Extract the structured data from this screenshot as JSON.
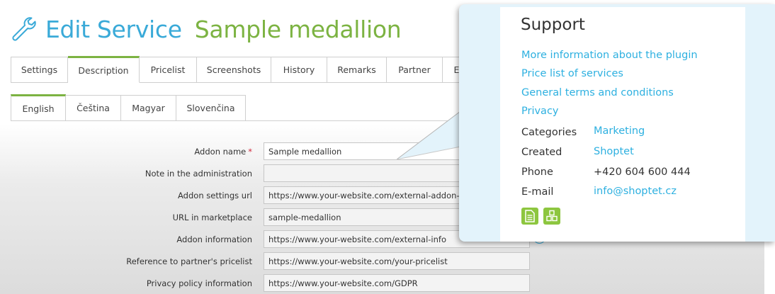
{
  "header": {
    "title": "Edit Service",
    "subtitle": "Sample medallion",
    "icon": "wrench-icon"
  },
  "tabs": [
    {
      "label": "Settings",
      "active": false
    },
    {
      "label": "Description",
      "active": true
    },
    {
      "label": "Pricelist",
      "active": false
    },
    {
      "label": "Screenshots",
      "active": false
    },
    {
      "label": "History",
      "active": false
    },
    {
      "label": "Remarks",
      "active": false
    },
    {
      "label": "Partner",
      "active": false
    },
    {
      "label": "E",
      "active": false
    }
  ],
  "language_tabs": [
    {
      "label": "English",
      "active": true
    },
    {
      "label": "Čeština",
      "active": false
    },
    {
      "label": "Magyar",
      "active": false
    },
    {
      "label": "Slovenčina",
      "active": false
    }
  ],
  "form": {
    "required_mark": "*",
    "fields": [
      {
        "label": "Addon name",
        "value": "Sample medallion"
      },
      {
        "label": "Note in the administration",
        "value": ""
      },
      {
        "label": "Addon settings url",
        "value": "https://www.your-website.com/external-addon-settings"
      },
      {
        "label": "URL in marketplace",
        "value": "sample-medallion"
      },
      {
        "label": "Addon information",
        "value": "https://www.your-website.com/external-info"
      },
      {
        "label": "Reference to partner's pricelist",
        "value": "https://www.your-website.com/your-pricelist"
      },
      {
        "label": "Privacy policy information",
        "value": "https://www.your-website.com/GDPR"
      }
    ],
    "info_glyph": "i"
  },
  "support": {
    "title": "Support",
    "links": [
      "More information about the plugin",
      "Price list of services",
      "General terms and conditions",
      "Privacy"
    ],
    "meta": [
      {
        "label": "Categories",
        "value": "Marketing",
        "is_link": true
      },
      {
        "label": "Created",
        "value": "Shoptet",
        "is_link": true
      },
      {
        "label": "Phone",
        "value": "+420 604 600 444",
        "is_link": false
      },
      {
        "label": "E-mail",
        "value": "info@shoptet.cz",
        "is_link": true
      }
    ],
    "icons": [
      "document-icon",
      "boxes-icon"
    ]
  },
  "colors": {
    "accent_blue": "#3aaad8",
    "accent_green": "#7cb342",
    "link_blue": "#2db0e0",
    "icon_green": "#8dc63f",
    "popup_bg": "#e3f3fb",
    "required_red": "#d0273a"
  }
}
